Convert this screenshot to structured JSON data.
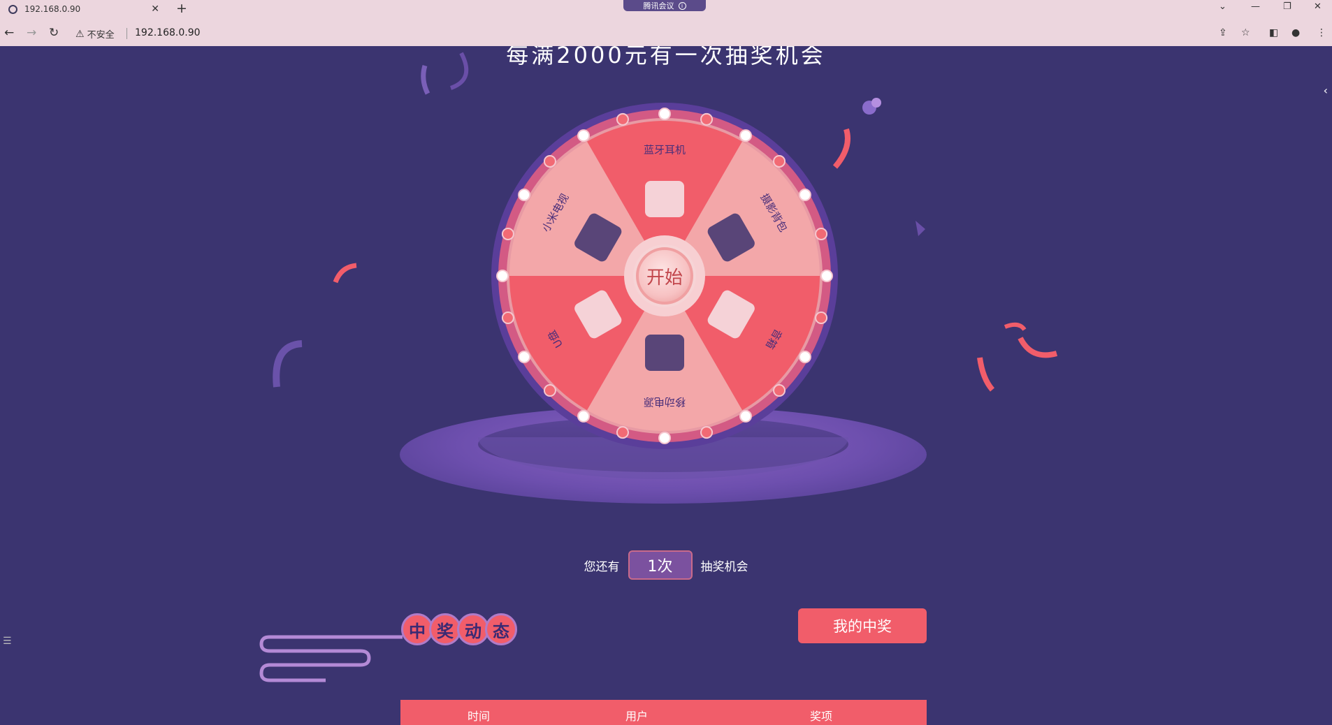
{
  "browser": {
    "tab_title": "192.168.0.90",
    "tab_close": "✕",
    "new_tab": "+",
    "meeting_label": "腾讯会议",
    "security_label": "不安全",
    "url": "192.168.0.90",
    "icons": [
      "globe-icon",
      "back-icon",
      "forward-icon",
      "reload-icon",
      "warning-icon",
      "share-icon",
      "star-icon",
      "sidepanel-icon",
      "profile-icon",
      "menu-icon"
    ]
  },
  "page": {
    "title": "每满2000元有一次抽奖机会",
    "start_label": "开始",
    "prizes": [
      {
        "name": "蓝牙耳机",
        "color": "#f15d6a"
      },
      {
        "name": "摄影背包",
        "color": "#f3a7a9"
      },
      {
        "name": "音箱",
        "color": "#f15d6a"
      },
      {
        "name": "移动电源",
        "color": "#f3a7a9"
      },
      {
        "name": "U盘",
        "color": "#f15d6a"
      },
      {
        "name": "小米电视",
        "color": "#f3a7a9"
      }
    ],
    "chances_prefix": "您还有",
    "chances_value": "1次",
    "chances_suffix": "抽奖机会",
    "news_title_chars": [
      "中",
      "奖",
      "动",
      "态"
    ],
    "my_prize_label": "我的中奖",
    "table_headers": [
      "时间",
      "用户",
      "奖项"
    ],
    "colors": {
      "background": "#3b3470",
      "accent": "#f15d6a",
      "wheel_light": "#f3a7a9"
    }
  }
}
